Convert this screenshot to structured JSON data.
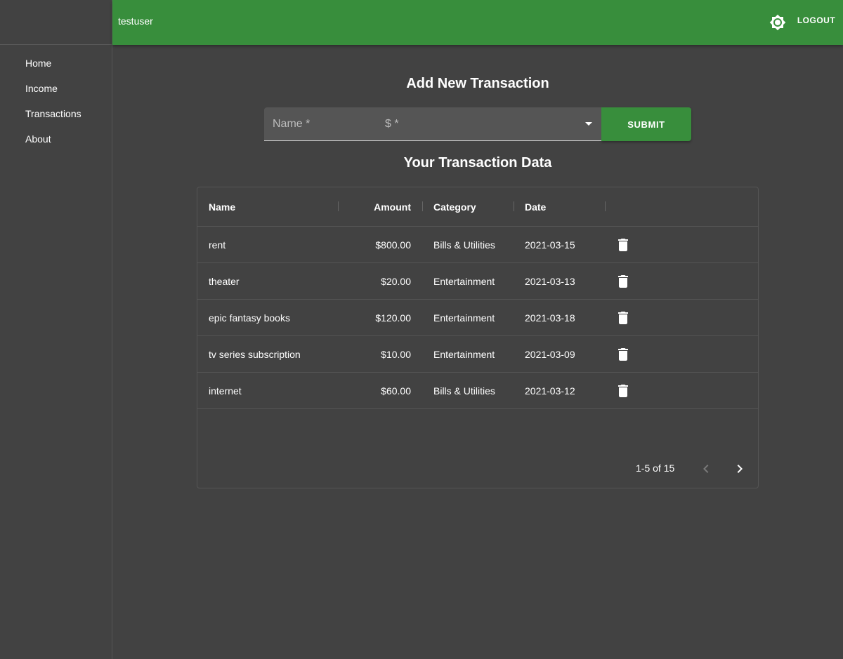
{
  "header": {
    "username": "testuser",
    "logout_label": "LOGOUT",
    "theme_icon": "brightness-icon"
  },
  "sidebar": {
    "items": [
      {
        "label": "Home"
      },
      {
        "label": "Income"
      },
      {
        "label": "Transactions"
      },
      {
        "label": "About"
      }
    ]
  },
  "form": {
    "title": "Add New Transaction",
    "name_placeholder": "Name *",
    "amount_placeholder": "$ *",
    "submit_label": "SUBMIT"
  },
  "table": {
    "title": "Your Transaction Data",
    "columns": [
      "Name",
      "Amount",
      "Category",
      "Date"
    ],
    "rows": [
      {
        "name": "rent",
        "amount": "$800.00",
        "category": "Bills & Utilities",
        "date": "2021-03-15"
      },
      {
        "name": "theater",
        "amount": "$20.00",
        "category": "Entertainment",
        "date": "2021-03-13"
      },
      {
        "name": "epic fantasy books",
        "amount": "$120.00",
        "category": "Entertainment",
        "date": "2021-03-18"
      },
      {
        "name": "tv series subscription",
        "amount": "$10.00",
        "category": "Entertainment",
        "date": "2021-03-09"
      },
      {
        "name": "internet",
        "amount": "$60.00",
        "category": "Bills & Utilities",
        "date": "2021-03-12"
      }
    ],
    "pagination": "1-5 of 15"
  },
  "colors": {
    "accent": "#388e3c",
    "background": "#424242",
    "field": "#555555"
  }
}
